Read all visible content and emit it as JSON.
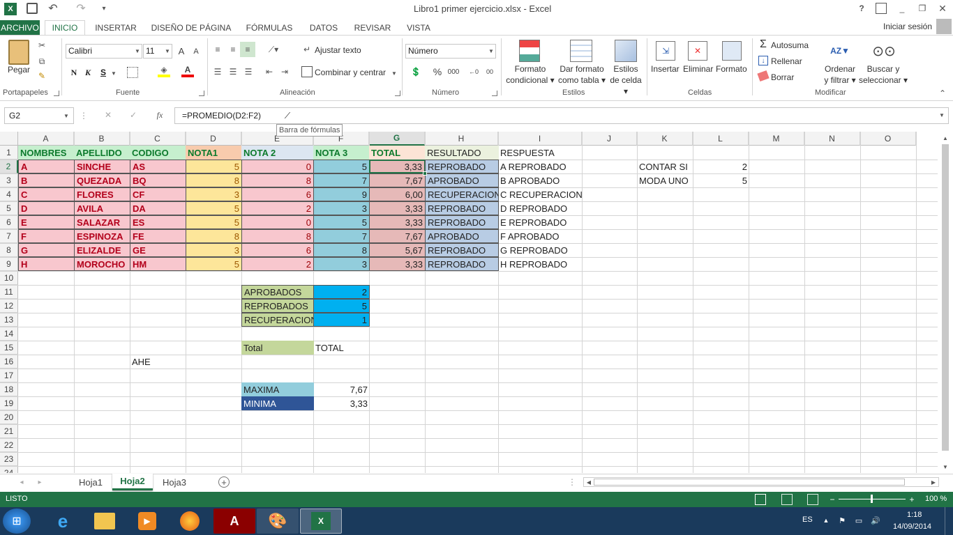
{
  "title": "Libro1 primer ejercicio.xlsx - Excel",
  "ribbon_tabs": [
    "ARCHIVO",
    "INICIO",
    "INSERTAR",
    "DISEÑO DE PÁGINA",
    "FÓRMULAS",
    "DATOS",
    "REVISAR",
    "VISTA"
  ],
  "signin": "Iniciar sesión",
  "window_controls": [
    "?",
    "▢",
    "_",
    "▭",
    "✕"
  ],
  "clipboard": {
    "paste": "Pegar",
    "group": "Portapapeles"
  },
  "font": {
    "name": "Calibri",
    "size": "11",
    "bold": "N",
    "italic": "K",
    "underline": "S",
    "group": "Fuente"
  },
  "align": {
    "wrap": "Ajustar texto",
    "merge": "Combinar y centrar",
    "group": "Alineación"
  },
  "number": {
    "format": "Número",
    "percent": "%",
    "thousands": "000",
    "group": "Número"
  },
  "styles": {
    "cond": "Formato condicional",
    "table": "Dar formato como tabla",
    "cell": "Estilos de celda",
    "group": "Estilos"
  },
  "cells": {
    "insert": "Insertar",
    "delete": "Eliminar",
    "format": "Formato",
    "group": "Celdas"
  },
  "edit": {
    "autosum": "Autosuma",
    "fill": "Rellenar",
    "clear": "Borrar",
    "sort": "Ordenar y filtrar",
    "find": "Buscar y seleccionar",
    "group": "Modificar"
  },
  "namebox": "G2",
  "formula": "=PROMEDIO(D2:F2)",
  "tooltip": "Barra de fórmulas",
  "cols": [
    "A",
    "B",
    "C",
    "D",
    "E",
    "F",
    "G",
    "H",
    "I",
    "J",
    "K",
    "L",
    "M",
    "N",
    "O"
  ],
  "rows": [
    "1",
    "2",
    "3",
    "4",
    "5",
    "6",
    "7",
    "8",
    "9",
    "10",
    "11",
    "12",
    "13",
    "14",
    "15",
    "16",
    "17",
    "18",
    "19",
    "20",
    "21",
    "22",
    "23",
    "24"
  ],
  "headers": [
    "NOMBRES",
    "APELLIDO",
    "CODIGO",
    "NOTA1",
    "NOTA 2",
    "NOTA 3",
    "TOTAL",
    "RESULTADO",
    "RESPUESTA"
  ],
  "students": [
    {
      "n": "A",
      "a": "SINCHE",
      "c": "AS",
      "d1": "5",
      "d2": "0",
      "d3": "5",
      "t": "3,33",
      "r": "REPROBADO",
      "s": "A REPROBADO"
    },
    {
      "n": "B",
      "a": "QUEZADA",
      "c": "BQ",
      "d1": "8",
      "d2": "8",
      "d3": "7",
      "t": "7,67",
      "r": "APROBADO",
      "s": "B APROBADO"
    },
    {
      "n": "C",
      "a": "FLORES",
      "c": "CF",
      "d1": "3",
      "d2": "6",
      "d3": "9",
      "t": "6,00",
      "r": "RECUPERACION",
      "s": "C RECUPERACION"
    },
    {
      "n": "D",
      "a": "AVILA",
      "c": "DA",
      "d1": "5",
      "d2": "2",
      "d3": "3",
      "t": "3,33",
      "r": "REPROBADO",
      "s": "D REPROBADO"
    },
    {
      "n": "E",
      "a": "SALAZAR",
      "c": "ES",
      "d1": "5",
      "d2": "0",
      "d3": "5",
      "t": "3,33",
      "r": "REPROBADO",
      "s": "E REPROBADO"
    },
    {
      "n": "F",
      "a": "ESPINOZA",
      "c": "FE",
      "d1": "8",
      "d2": "8",
      "d3": "7",
      "t": "7,67",
      "r": "APROBADO",
      "s": "F APROBADO"
    },
    {
      "n": "G",
      "a": "ELIZALDE",
      "c": "GE",
      "d1": "3",
      "d2": "6",
      "d3": "8",
      "t": "5,67",
      "r": "REPROBADO",
      "s": "G REPROBADO"
    },
    {
      "n": "H",
      "a": "MOROCHO",
      "c": "HM",
      "d1": "5",
      "d2": "2",
      "d3": "3",
      "t": "3,33",
      "r": "REPROBADO",
      "s": "H REPROBADO"
    }
  ],
  "side": [
    {
      "label": "CONTAR SI",
      "value": "2"
    },
    {
      "label": "MODA UNO",
      "value": "5"
    }
  ],
  "summary": [
    {
      "label": "APROBADOS",
      "value": "2"
    },
    {
      "label": "REPROBADOS",
      "value": "5"
    },
    {
      "label": "RECUPERACION",
      "value": "1"
    }
  ],
  "total": {
    "label": "Total",
    "value": "TOTAL"
  },
  "ahe": "AHE",
  "maxmin": [
    {
      "label": "MAXIMA",
      "value": "7,67"
    },
    {
      "label": "MINIMA",
      "value": "3,33"
    }
  ],
  "sheets": [
    "Hoja1",
    "Hoja2",
    "Hoja3"
  ],
  "status": {
    "ready": "LISTO",
    "zoom": "100 %"
  },
  "tray": {
    "lang": "ES",
    "time": "1:18",
    "date": "14/09/2014"
  },
  "colors": {
    "excel_green": "#217346",
    "header_green": "#0c7a2c",
    "pink": "#f8c7ce",
    "yellow": "#fde69a",
    "blue": "#92cddc",
    "lightblue": "#b8cce4",
    "totalpink": "#e6b9b8",
    "olive": "#c4d79b",
    "cyan": "#00b0f0",
    "navy": "#2f5597"
  }
}
